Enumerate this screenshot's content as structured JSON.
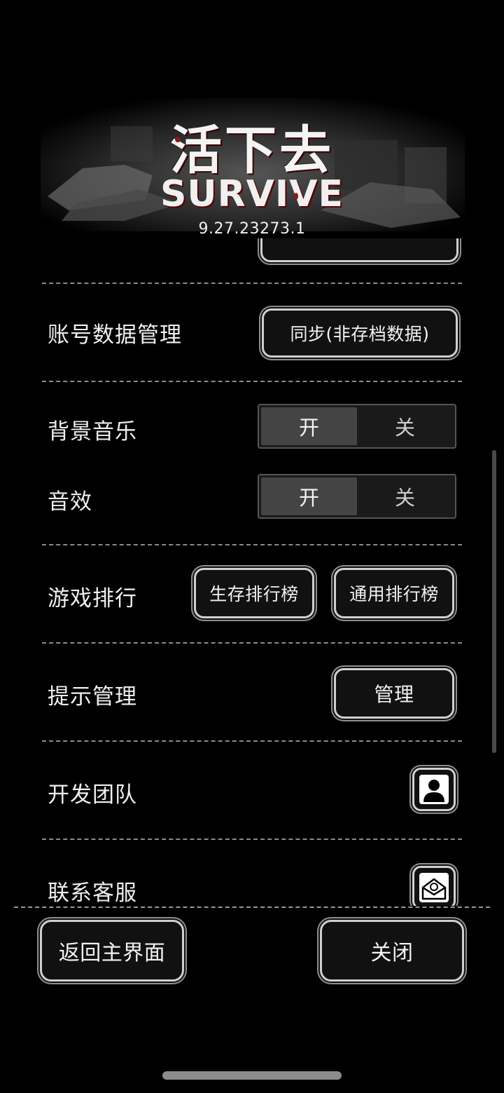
{
  "header": {
    "logo_text_cn": "活下去",
    "logo_text_en": "SURVIVE",
    "version": "9.27.23273.1"
  },
  "settings": {
    "account": {
      "label": "账号数据管理",
      "button": "同步(非存档数据)"
    },
    "music": {
      "label": "背景音乐",
      "on": "开",
      "off": "关",
      "state": "on"
    },
    "sfx": {
      "label": "音效",
      "on": "开",
      "off": "关",
      "state": "on"
    },
    "ranking": {
      "label": "游戏排行",
      "survival_button": "生存排行榜",
      "general_button": "通用排行榜"
    },
    "hints": {
      "label": "提示管理",
      "button": "管理"
    },
    "team": {
      "label": "开发团队",
      "icon": "person-icon"
    },
    "support": {
      "label": "联系客服",
      "icon": "mail-icon"
    }
  },
  "footer": {
    "home_button": "返回主界面",
    "close_button": "关闭"
  },
  "colors": {
    "background": "#000000",
    "button_border": "#cfcfcf",
    "toggle_on": "#444444",
    "logo_blood": "#8b1a1a"
  }
}
